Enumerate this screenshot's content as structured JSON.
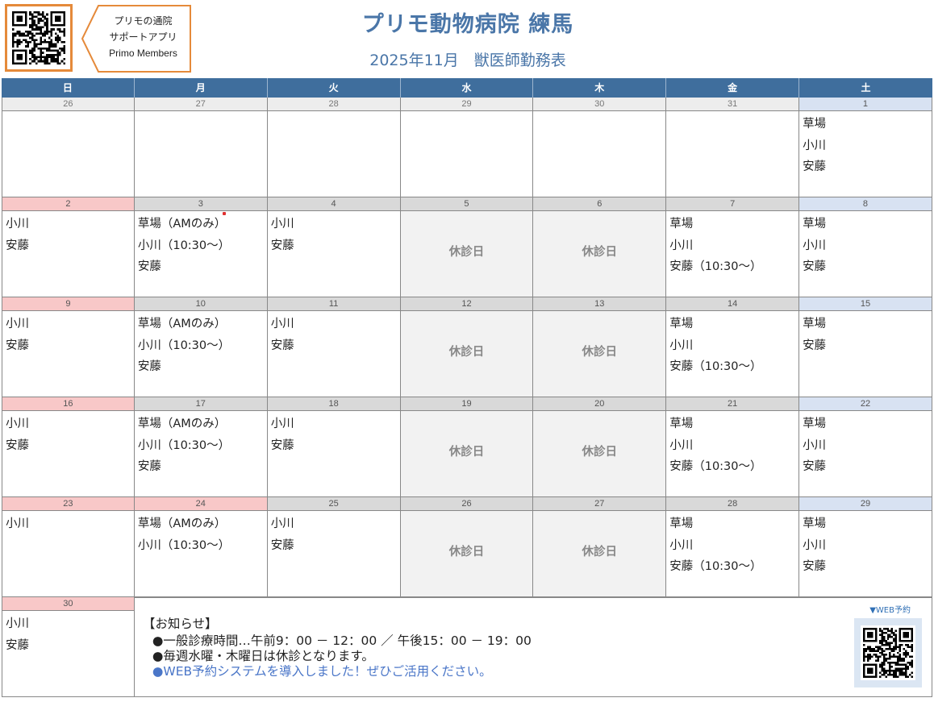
{
  "header": {
    "app_tag": [
      "プリモの通院",
      "サポートアプリ",
      "Primo Members"
    ],
    "title": "プリモ動物病院  練馬",
    "subtitle": "2025年11月　獣医師勤務表",
    "accent_color": "#4a76a8",
    "tag_border_color": "#e58a3a"
  },
  "calendar": {
    "weekdays": [
      "日",
      "月",
      "火",
      "水",
      "木",
      "金",
      "土"
    ],
    "closed_label": "休診日",
    "weeks": [
      {
        "dates": [
          "26",
          "27",
          "28",
          "29",
          "30",
          "31",
          "1"
        ],
        "cells": [
          [],
          [],
          [],
          [],
          [],
          [],
          [
            "草場",
            "小川",
            "安藤"
          ]
        ]
      },
      {
        "dates": [
          "2",
          "3",
          "4",
          "5",
          "6",
          "7",
          "8"
        ],
        "cells": [
          [
            "小川",
            "安藤"
          ],
          [
            "草場（AMのみ）",
            "小川（10:30～）",
            "安藤"
          ],
          [
            "小川",
            "安藤"
          ],
          [],
          [],
          [
            "草場",
            "小川",
            "安藤（10:30～）"
          ],
          [
            "草場",
            "小川",
            "安藤"
          ]
        ]
      },
      {
        "dates": [
          "9",
          "10",
          "11",
          "12",
          "13",
          "14",
          "15"
        ],
        "cells": [
          [
            "小川",
            "安藤"
          ],
          [
            "草場（AMのみ）",
            "小川（10:30～）",
            "安藤"
          ],
          [
            "小川",
            "安藤"
          ],
          [],
          [],
          [
            "草場",
            "小川",
            "安藤（10:30～）"
          ],
          [
            "草場",
            "安藤"
          ]
        ]
      },
      {
        "dates": [
          "16",
          "17",
          "18",
          "19",
          "20",
          "21",
          "22"
        ],
        "cells": [
          [
            "小川",
            "安藤"
          ],
          [
            "草場（AMのみ）",
            "小川（10:30～）",
            "安藤"
          ],
          [
            "小川",
            "安藤"
          ],
          [],
          [],
          [
            "草場",
            "小川",
            "安藤（10:30～）"
          ],
          [
            "草場",
            "小川",
            "安藤"
          ]
        ]
      },
      {
        "dates": [
          "23",
          "24",
          "25",
          "26",
          "27",
          "28",
          "29"
        ],
        "cells": [
          [
            "小川"
          ],
          [
            "草場（AMのみ）",
            "小川（10:30～）"
          ],
          [
            "小川",
            "安藤"
          ],
          [],
          [],
          [
            "草場",
            "小川",
            "安藤（10:30～）"
          ],
          [
            "草場",
            "小川",
            "安藤"
          ]
        ]
      }
    ],
    "last": {
      "date": "30",
      "cell": [
        "小川",
        "安藤"
      ]
    }
  },
  "notice": {
    "title": "【お知らせ】",
    "line1": "●一般診療時間…午前9：00 － 12：00 ／ 午後15：00 － 19：00",
    "line2": "●毎週水曜・木曜日は休診となります。",
    "line3": "●WEB予約システムを導入しました！ぜひご活用ください。",
    "web_label": "▼WEB予約"
  }
}
